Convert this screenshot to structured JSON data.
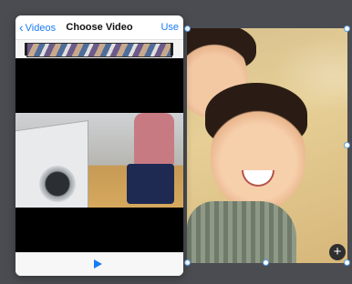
{
  "picker": {
    "back_label": "Videos",
    "title": "Choose Video",
    "use_label": "Use"
  },
  "canvas": {
    "add_symbol": "+"
  },
  "icons": {
    "back": "chevron-left-icon",
    "play": "play-icon",
    "add": "plus-icon"
  },
  "colors": {
    "accent": "#1a7cf5",
    "canvas_background": "#4b4c51",
    "selection_handle": "#5aa0e6"
  }
}
